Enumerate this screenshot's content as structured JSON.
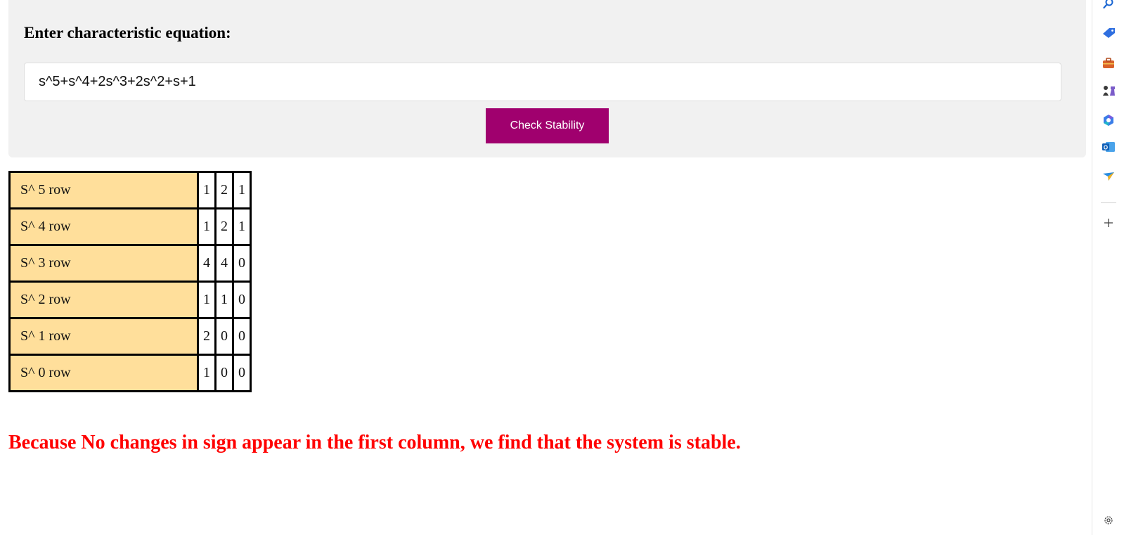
{
  "form": {
    "label": "Enter characteristic equation:",
    "equation_value": "s^5+s^4+2s^3+2s^2+s+1",
    "button_label": "Check Stability"
  },
  "routh_table": {
    "rows": [
      {
        "label": "S^ 5 row",
        "values": [
          "1",
          "2",
          "1"
        ]
      },
      {
        "label": "S^ 4 row",
        "values": [
          "1",
          "2",
          "1"
        ]
      },
      {
        "label": "S^ 3 row",
        "values": [
          "4",
          "4",
          "0"
        ]
      },
      {
        "label": "S^ 2 row",
        "values": [
          "1",
          "1",
          "0"
        ]
      },
      {
        "label": "S^ 1 row",
        "values": [
          "2",
          "0",
          "0"
        ]
      },
      {
        "label": "S^ 0 row",
        "values": [
          "1",
          "0",
          "0"
        ]
      }
    ]
  },
  "result": {
    "text": "Because No changes in sign appear in the first column, we find that the system is stable.",
    "color": "#ff0000"
  },
  "colors": {
    "button_bg": "#a0006e",
    "row_label_bg": "#ffdf9b",
    "card_bg": "#f1f1f1"
  },
  "side_panel": {
    "icons": [
      "search-icon",
      "tag-icon",
      "briefcase-icon",
      "chess-icon",
      "copilot-icon",
      "outlook-icon",
      "send-icon",
      "add-icon",
      "settings-icon"
    ]
  }
}
